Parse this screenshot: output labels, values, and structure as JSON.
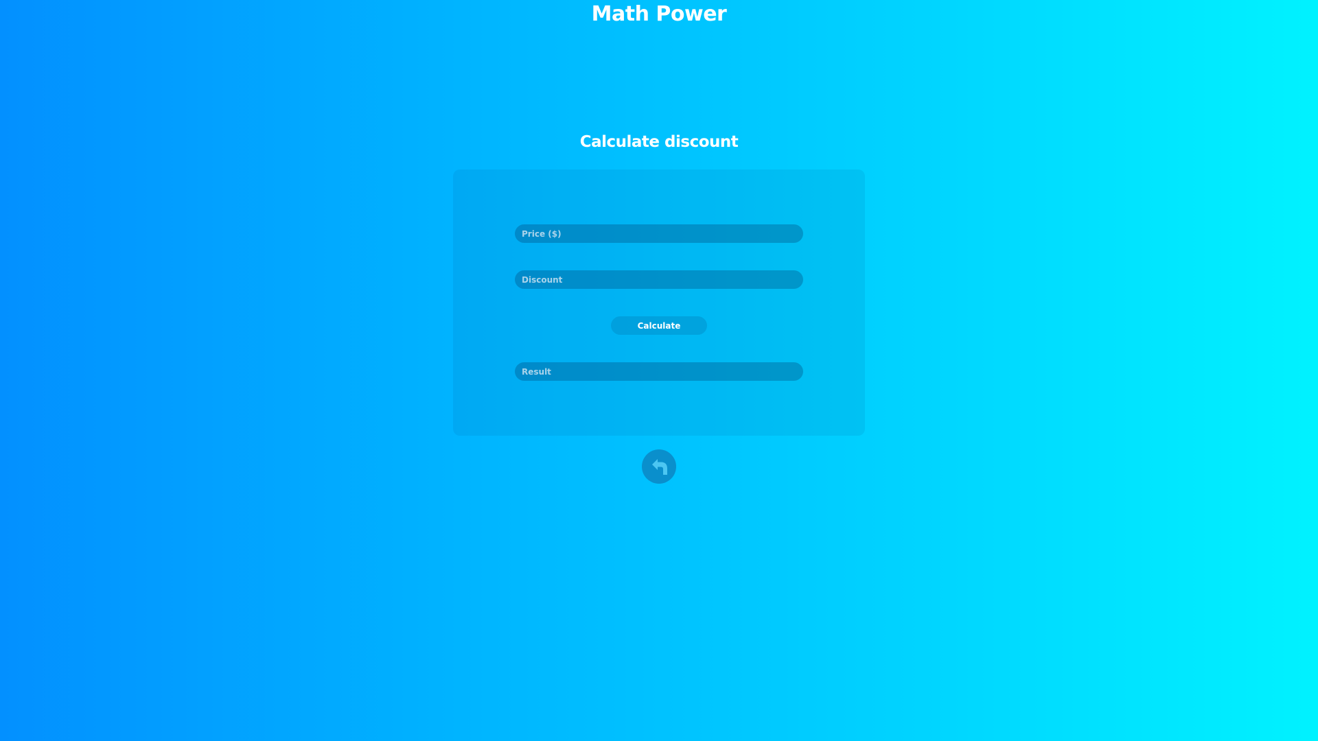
{
  "app": {
    "title": "Math Power"
  },
  "page": {
    "heading": "Calculate discount"
  },
  "form": {
    "price": {
      "placeholder": "Price ($)",
      "value": ""
    },
    "discount": {
      "placeholder": "Discount",
      "value": ""
    },
    "calculate_label": "Calculate",
    "result": {
      "placeholder": "Result",
      "value": ""
    }
  },
  "icons": {
    "back": "back-arrow-icon"
  },
  "colors": {
    "gradient_start": "#0390ff",
    "gradient_end": "#00f2ff",
    "text": "#ffffff",
    "back_button": "#0a8fcc"
  }
}
